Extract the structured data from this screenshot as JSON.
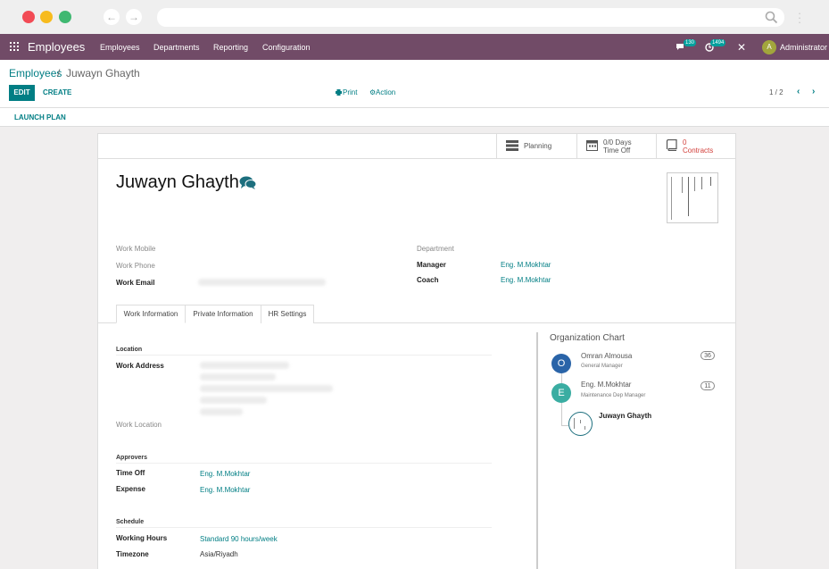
{
  "navbar": {
    "brand": "Employees",
    "menus": [
      "Employees",
      "Departments",
      "Reporting",
      "Configuration"
    ],
    "messages_count": "130",
    "activities_count": "1494",
    "user": "Administrator",
    "user_initial": "A"
  },
  "breadcrumb": {
    "root": "Employees",
    "sep": "/",
    "current": "Juwayn Ghayth"
  },
  "toolbar": {
    "edit": "EDIT",
    "create": "CREATE",
    "print": "Print",
    "action": "Action",
    "pager": "1 / 2"
  },
  "statusbar": {
    "launch_plan": "LAUNCH PLAN"
  },
  "smart_buttons": {
    "planning": "Planning",
    "timeoff_value": "0/0 Days",
    "timeoff_label": "Time Off",
    "contracts_value": "0",
    "contracts_label": "Contracts"
  },
  "employee": {
    "name": "Juwayn Ghayth"
  },
  "fields": {
    "work_mobile": "Work Mobile",
    "work_phone": "Work Phone",
    "work_email": "Work Email",
    "department": "Department",
    "manager": "Manager",
    "manager_value": "Eng. M.Mokhtar",
    "coach": "Coach",
    "coach_value": "Eng. M.Mokhtar"
  },
  "tabs": [
    "Work Information",
    "Private Information",
    "HR Settings"
  ],
  "work_info": {
    "location_group": "Location",
    "work_address": "Work Address",
    "work_location": "Work Location",
    "approvers_group": "Approvers",
    "time_off": "Time Off",
    "time_off_value": "Eng. M.Mokhtar",
    "expense": "Expense",
    "expense_value": "Eng. M.Mokhtar",
    "schedule_group": "Schedule",
    "working_hours": "Working Hours",
    "working_hours_value": "Standard 90 hours/week",
    "timezone": "Timezone",
    "timezone_value": "Asia/Riyadh"
  },
  "org_chart": {
    "title": "Organization Chart",
    "nodes": [
      {
        "initial": "O",
        "name": "Omran Almousa",
        "job": "General Manager",
        "count": "36",
        "color": "#2a64a8"
      },
      {
        "initial": "E",
        "name": "Eng. M.Mokhtar",
        "job": "Maintenance Dep Manager",
        "count": "11",
        "color": "#3aada2"
      }
    ],
    "self": "Juwayn Ghayth"
  },
  "colors": {
    "navbar": "#714b67",
    "primary": "#017e84",
    "danger": "#d23f3a"
  }
}
